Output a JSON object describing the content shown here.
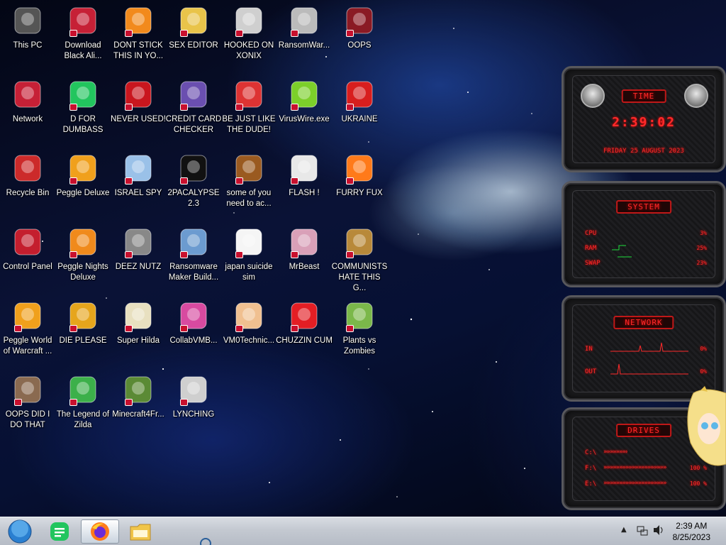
{
  "desktop": {
    "icons": [
      {
        "label": "This PC",
        "icon": "computer-icon"
      },
      {
        "label": "Download Black Ali...",
        "icon": "alien-head-icon"
      },
      {
        "label": "DONT STICK THIS IN YO...",
        "icon": "traffic-cone-icon"
      },
      {
        "label": "SEX EDITOR",
        "icon": "hex-editor-icon"
      },
      {
        "label": "HOOKED ON XONIX",
        "icon": "xonix-game-icon"
      },
      {
        "label": "RansomWar...",
        "icon": "skull-icon"
      },
      {
        "label": "OOPS",
        "icon": "alien-laptop-icon"
      },
      {
        "label": "Network",
        "icon": "network-alien-icon"
      },
      {
        "label": "D FOR DUMBASS",
        "icon": "green-d-icon"
      },
      {
        "label": "NEVER USED!",
        "icon": "dev-cpp-icon"
      },
      {
        "label": "CREDIT CARD CHECKER",
        "icon": "credit-card-icon"
      },
      {
        "label": "BE JUST LIKE THE DUDE!",
        "icon": "santa-icon"
      },
      {
        "label": "VirusWire.exe",
        "icon": "lime-icon"
      },
      {
        "label": "UKRAINE",
        "icon": "radiation-icon"
      },
      {
        "label": "Recycle Bin",
        "icon": "recycle-bin-icon"
      },
      {
        "label": "Peggle Deluxe",
        "icon": "peggle-icon"
      },
      {
        "label": "ISRAEL SPY",
        "icon": "spy-computer-icon"
      },
      {
        "label": "2PACALYPSE 2.3",
        "icon": "console-icon"
      },
      {
        "label": "some of you need to ac...",
        "icon": "dog-icon"
      },
      {
        "label": "FLASH !",
        "icon": "flash-icon"
      },
      {
        "label": "FURRY FUX",
        "icon": "firefox-icon"
      },
      {
        "label": "Control Panel",
        "icon": "control-panel-icon"
      },
      {
        "label": "Peggle Nights Deluxe",
        "icon": "peggle-nights-icon"
      },
      {
        "label": "DEEZ NUTZ",
        "icon": "stacked-windows-icon"
      },
      {
        "label": "Ransomware Maker Build...",
        "icon": "window-app-icon"
      },
      {
        "label": "japan suicide sim",
        "icon": "document-icon"
      },
      {
        "label": "MrBeast",
        "icon": "mrbeast-icon"
      },
      {
        "label": "COMMUNISTS HATE THIS G...",
        "icon": "money-bag-icon"
      },
      {
        "label": "Peggle World of Warcraft ...",
        "icon": "peggle-wow-icon"
      },
      {
        "label": "DIE PLEASE",
        "icon": "de-icon"
      },
      {
        "label": "Super Hilda",
        "icon": "pixel-art-icon"
      },
      {
        "label": "CollabVMB...",
        "icon": "vm-screen-icon"
      },
      {
        "label": "VM0Technic...",
        "icon": "technician-icon"
      },
      {
        "label": "CHUZZIN CUM",
        "icon": "chuzzle-icon"
      },
      {
        "label": "Plants vs Zombies",
        "icon": "plants-icon"
      },
      {
        "label": "OOPS DID I DO THAT",
        "icon": "portrait-icon"
      },
      {
        "label": "The Legend of Zilda",
        "icon": "zelda-icon"
      },
      {
        "label": "Minecraft4Fr...",
        "icon": "minecraft-icon"
      },
      {
        "label": "LYNCHING",
        "icon": "noose-icon"
      }
    ]
  },
  "gadget": {
    "time": {
      "title": "TIME",
      "clock": "2:39:02",
      "date": "FRIDAY 25 AUGUST 2023"
    },
    "system": {
      "title": "SYSTEM",
      "rows": [
        {
          "label": "CPU",
          "value": "3%"
        },
        {
          "label": "RAM",
          "value": "25%"
        },
        {
          "label": "SWAP",
          "value": "23%"
        }
      ]
    },
    "network": {
      "title": "NETWORK",
      "rows": [
        {
          "label": "IN",
          "value": "0%"
        },
        {
          "label": "OUT",
          "value": "0%"
        }
      ]
    },
    "drives": {
      "title": "DRIVES",
      "rows": [
        {
          "label": "C:\\",
          "value": ""
        },
        {
          "label": "F:\\",
          "value": "100 %"
        },
        {
          "label": "E:\\",
          "value": "100 %"
        }
      ]
    },
    "accent_color": "#ff2a2a"
  },
  "taskbar": {
    "buttons": [
      {
        "name": "start-orb",
        "icon": "windows-orb-icon"
      },
      {
        "name": "green-app",
        "icon": "green-d-icon"
      },
      {
        "name": "firefox",
        "icon": "firefox-icon"
      },
      {
        "name": "file-explorer",
        "icon": "folder-icon"
      }
    ],
    "time": "2:39 AM",
    "date": "8/25/2023"
  }
}
